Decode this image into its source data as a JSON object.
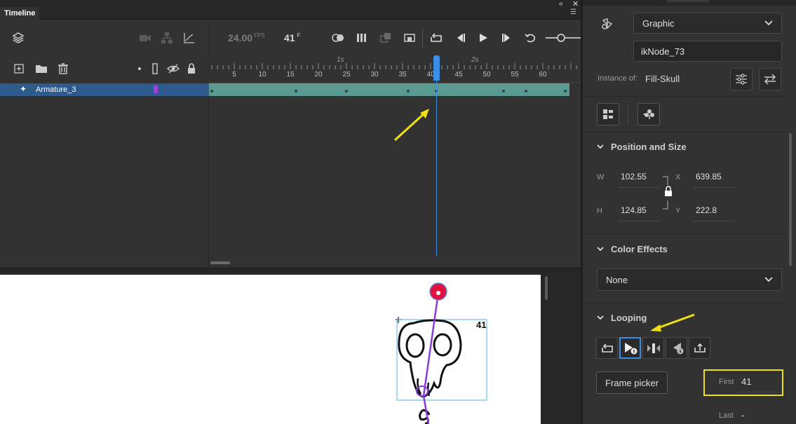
{
  "timeline": {
    "tab_label": "Timeline",
    "fps_value": "24.00",
    "fps_unit": "FPS",
    "current_frame": "41",
    "frame_unit": "F",
    "ruler": {
      "ticks": [
        5,
        10,
        15,
        20,
        25,
        30,
        35,
        40,
        45,
        50,
        55,
        60
      ],
      "seconds": [
        "1s",
        "2s"
      ]
    },
    "layer": {
      "name": "Armature_3",
      "color": "#a040e0"
    },
    "keyframes": [
      1,
      16,
      25,
      36,
      41,
      53,
      57,
      64
    ],
    "frames_color": "#5a9990",
    "playhead_color": "#3a8ee6"
  },
  "stage": {
    "frame_badge": "41",
    "bone_color": "#8a3ad6",
    "bone_tip_color": "#e01040",
    "selection_color": "#4fb3e0"
  },
  "properties": {
    "symbol_type": "Graphic",
    "instance_name": "ikNode_73",
    "instance_of_label": "Instance of:",
    "instance_of_value": "Fill-Skull",
    "position_size": {
      "title": "Position and Size",
      "w_label": "W",
      "w_value": "102.55",
      "h_label": "H",
      "h_value": "124.85",
      "x_label": "X",
      "x_value": "639.85",
      "y_label": "Y",
      "y_value": "222.8"
    },
    "color_effects": {
      "title": "Color Effects",
      "value": "None"
    },
    "looping": {
      "title": "Looping",
      "frame_picker_label": "Frame picker",
      "first_label": "First",
      "first_value": "41",
      "last_label": "Last",
      "last_value": "-"
    }
  },
  "annotations": {
    "arrow_color": "#f0e010",
    "highlight_color": "#f0e010"
  }
}
